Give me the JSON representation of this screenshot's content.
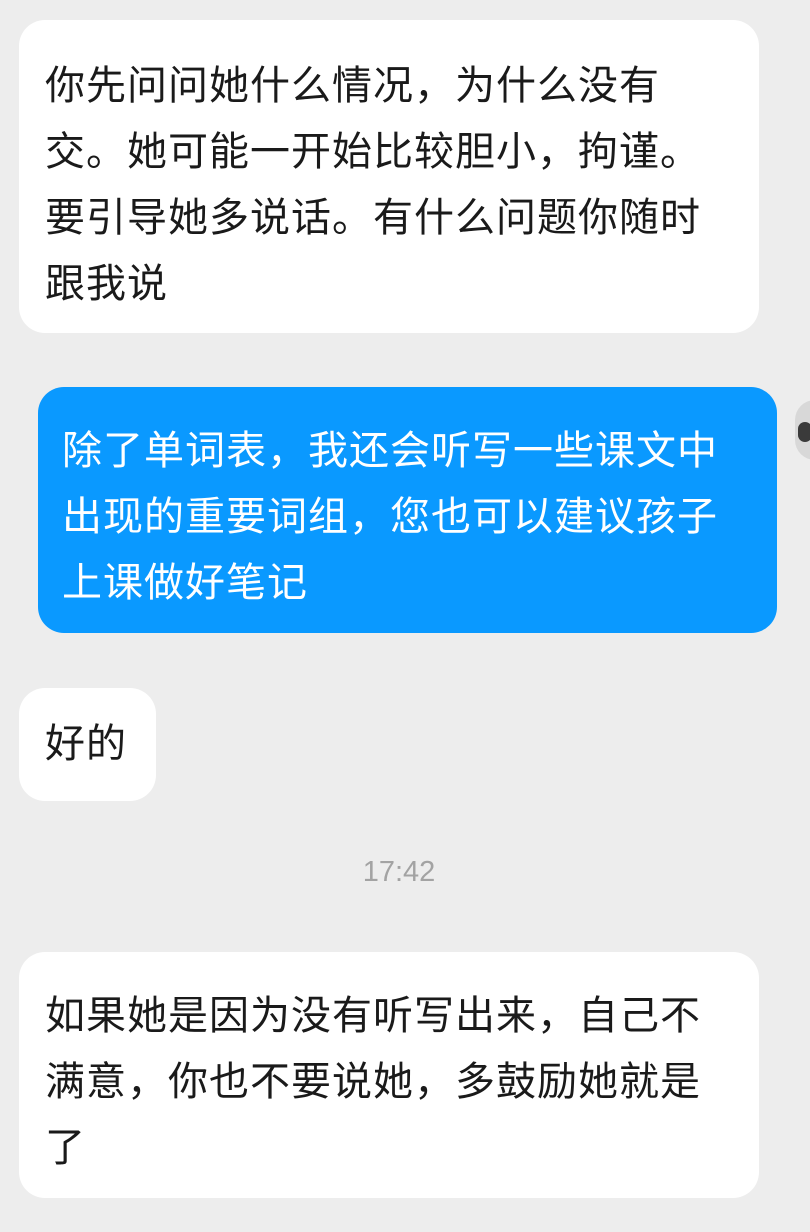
{
  "messages": [
    {
      "direction": "incoming",
      "text": "你先问问她什么情况，为什么没有交。她可能一开始比较胆小，拘谨。要引导她多说话。有什么问题你随时跟我说"
    },
    {
      "direction": "outgoing",
      "text": "除了单词表，我还会听写一些课文中出现的重要词组，您也可以建议孩子上课做好笔记"
    },
    {
      "direction": "incoming",
      "text": "好的"
    },
    {
      "direction": "incoming",
      "text": "如果她是因为没有听写出来，自己不满意，你也不要说她，多鼓励她就是了"
    }
  ],
  "timestamp": "17:42",
  "colors": {
    "background": "#ededed",
    "incoming_bubble": "#ffffff",
    "outgoing_bubble": "#0a99ff",
    "incoming_text": "#1a1a1a",
    "outgoing_text": "#ffffff",
    "timestamp_text": "#a3a3a3"
  },
  "icons": {
    "own_avatar": "avatar-icon"
  }
}
